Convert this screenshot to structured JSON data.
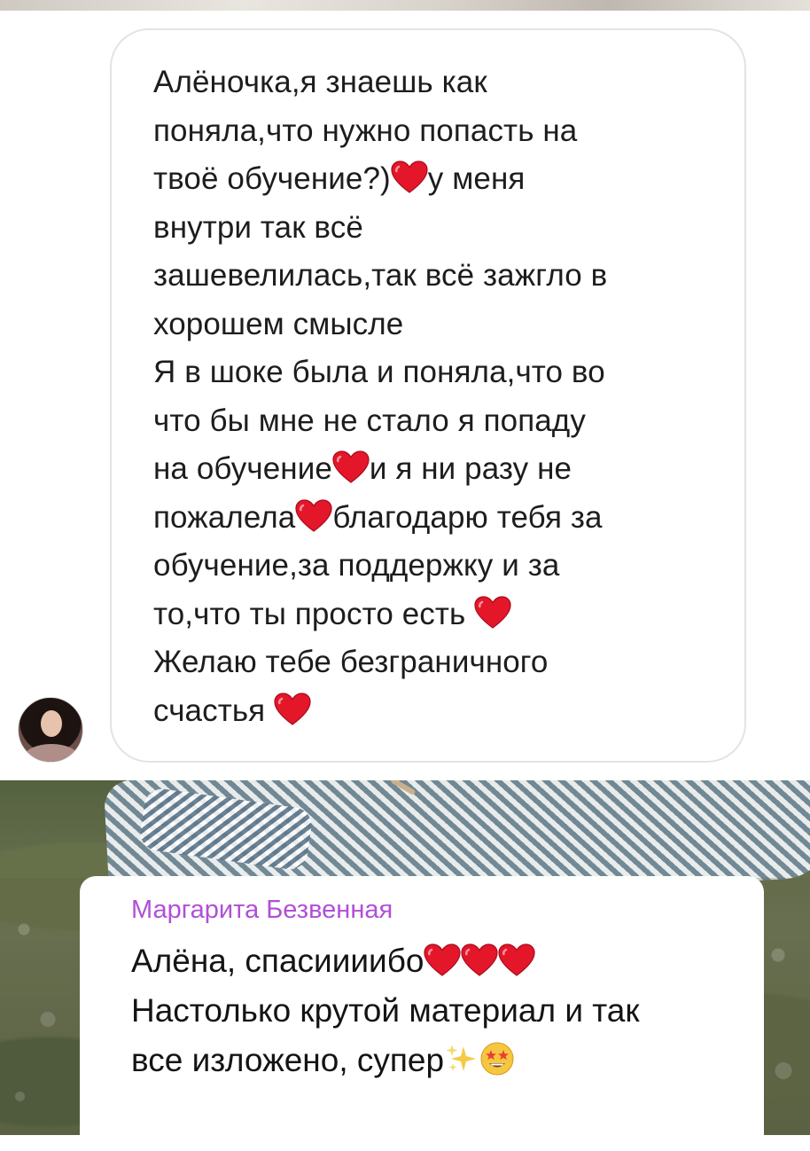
{
  "top_message": {
    "lines": [
      "Алёночка,я знаешь как",
      "поняла,что нужно попасть на",
      [
        "твоё обучение?)",
        "heart",
        "у меня"
      ],
      "внутри так всё",
      "зашевелилась,так всё зажгло в",
      "хорошем смысле",
      "Я в шоке была и поняла,что во",
      "что бы мне не стало я попаду",
      [
        "на обучение",
        "heart",
        "и я ни разу не"
      ],
      [
        "пожалела",
        "heart",
        "благодарю тебя за"
      ],
      "обучение,за поддержку и за",
      [
        "то,что ты просто есть ",
        "heart",
        ""
      ],
      "Желаю тебе безграничного",
      [
        "счастья ",
        "heart",
        ""
      ]
    ]
  },
  "bottom_message": {
    "sender": "Маргарита Безвенная",
    "lines": [
      [
        "Алёна, спасиииибо",
        "heart",
        "heart",
        "heart"
      ],
      "Настолько крутой материал и так",
      [
        "все изложено, супер",
        "sparkles",
        "star-struck-face"
      ]
    ]
  },
  "colors": {
    "heart": "#e4162a",
    "sender": "#b14fd6",
    "bubble_border": "#e3e3e3"
  },
  "icons": {
    "heart": "red-heart-icon",
    "sparkles": "sparkles-icon",
    "star-struck-face": "star-struck-face-icon"
  }
}
